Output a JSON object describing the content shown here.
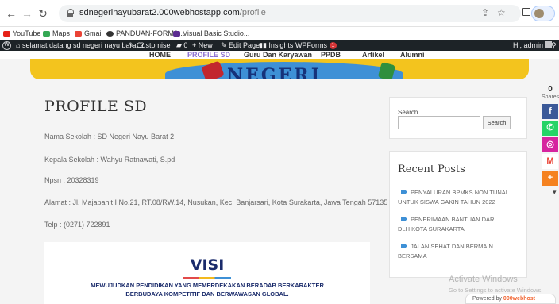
{
  "browser": {
    "url_host": "sdnegerinayubarat2.000webhostapp.com",
    "url_path": "/profile",
    "profile_status": "Paused",
    "bookmarks": [
      "YouTube",
      "Maps",
      "Gmail",
      "PANDUAN-FORMA...",
      "Visual Basic Studio..."
    ]
  },
  "adminbar": {
    "site_name": "selamat datang sd negeri nayu barat 2",
    "customise": "Customise",
    "comments": "0",
    "new": "New",
    "edit_page": "Edit Page",
    "insights": "Insights",
    "wpforms": "WPForms",
    "wpforms_badge": "1",
    "greeting": "Hi, admin"
  },
  "site_nav": [
    "HOME",
    "PROFILE SD",
    "Guru Dan Karyawan",
    "PPDB",
    "Artikel",
    "Alumni"
  ],
  "hero": {
    "text": "NEGERI"
  },
  "page": {
    "title": "PROFILE SD",
    "info": [
      "Nama Sekolah : SD Negeri Nayu Barat 2",
      "Kepala Sekolah : Wahyu Ratnawati, S.pd",
      "Npsn : 20328319",
      "Alamat : Jl. Majapahit I No.21, RT.08/RW.14, Nusukan, Kec. Banjarsari, Kota Surakarta, Jawa Tengah 57135",
      "Telp : (0271) 722891"
    ],
    "visi": {
      "title": "VISI",
      "line1": "MEWUJUDKAN PENDIDIKAN YANG MEMERDEKAKAN BERADAB BERKARAKTER",
      "line2": "BERBUDAYA KOMPETITIF DAN BERWAWASAN GLOBAL."
    }
  },
  "sidebar": {
    "search_label": "Search",
    "search_button": "Search",
    "recent_title": "Recent Posts",
    "posts": [
      "PENYALURAN BPMKS NON TUNAI UNTUK SISWA GAKIN TAHUN 2022",
      "PENERIMAAN BANTUAN DARI DLH KOTA SURAKARTA",
      "JALAN SEHAT DAN BERMAIN BERSAMA"
    ]
  },
  "share": {
    "count": "0",
    "label": "Shares",
    "colors": {
      "facebook": "#3b5998",
      "whatsapp": "#25d366",
      "instagram": "#d6249f",
      "gmail": "#ea4335",
      "more": "#f58220"
    }
  },
  "overlay": {
    "activate_title": "Activate Windows",
    "activate_sub": "Go to Settings to activate Windows.",
    "powered_by": "Powered by",
    "powered_brand": "000webhost"
  }
}
